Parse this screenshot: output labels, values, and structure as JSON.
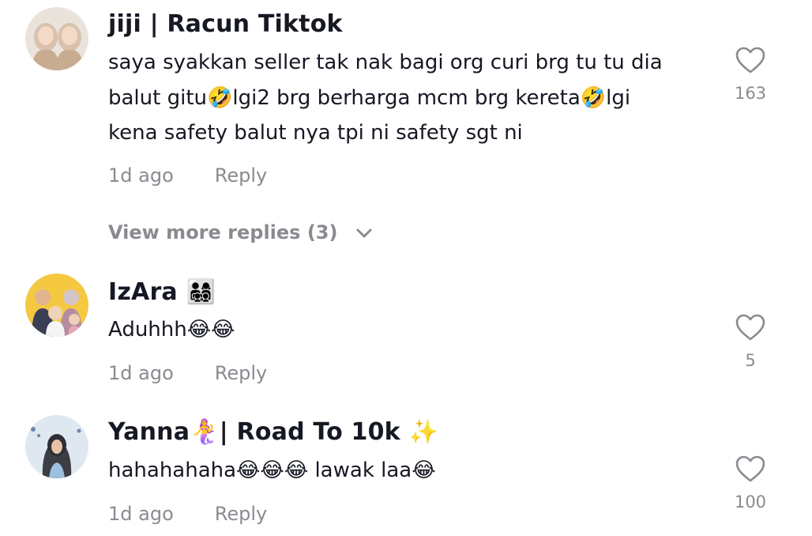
{
  "comments": [
    {
      "username": "jiji | Racun Tiktok",
      "lines": [
        "saya syakkan seller tak nak bagi org curi brg tu tu dia",
        "balut gitu🤣lgi2 brg berharga mcm brg kereta🤣lgi",
        "kena safety balut nya tpi ni safety sgt ni"
      ],
      "time": "1d ago",
      "reply_label": "Reply",
      "likes": "163",
      "more_replies": "View more replies (3)"
    },
    {
      "username": "IzAra 👨‍👩‍👧‍👦",
      "lines": [
        "Aduhhh😂😂"
      ],
      "time": "1d ago",
      "reply_label": "Reply",
      "likes": "5"
    },
    {
      "username": "Yanna🧜‍♀️| Road To 10k ✨",
      "lines": [
        "hahahahaha😂😂😂 lawak laa😂"
      ],
      "time": "1d ago",
      "reply_label": "Reply",
      "likes": "100"
    }
  ],
  "icons": {
    "like": "heart-outline-icon",
    "expand": "chevron-down-icon"
  },
  "colors": {
    "text_primary": "#161823",
    "text_secondary": "#8a8b91",
    "background": "#ffffff"
  }
}
